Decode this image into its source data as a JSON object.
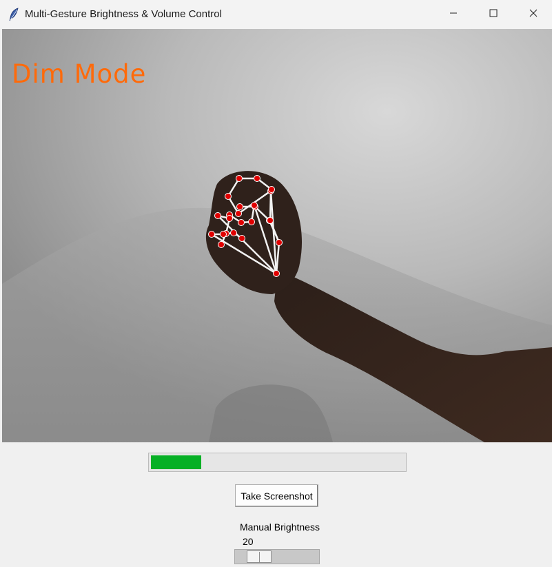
{
  "window": {
    "title": "Multi-Gesture Brightness & Volume Control",
    "icon": "feather-icon",
    "controls": [
      "minimize-icon",
      "maximize-icon",
      "close-icon"
    ]
  },
  "video": {
    "mode_text": "Dim Mode",
    "mode_color": "#ff6a0a",
    "landmark_color": "#e00000",
    "connection_color": "#f2f2f2"
  },
  "level_bar": {
    "fraction": 0.2,
    "fill_color": "#06b025"
  },
  "screenshot_button": {
    "label": "Take Screenshot"
  },
  "brightness_slider": {
    "label": "Manual Brightness",
    "value": "20",
    "min": 0,
    "max": 100
  }
}
